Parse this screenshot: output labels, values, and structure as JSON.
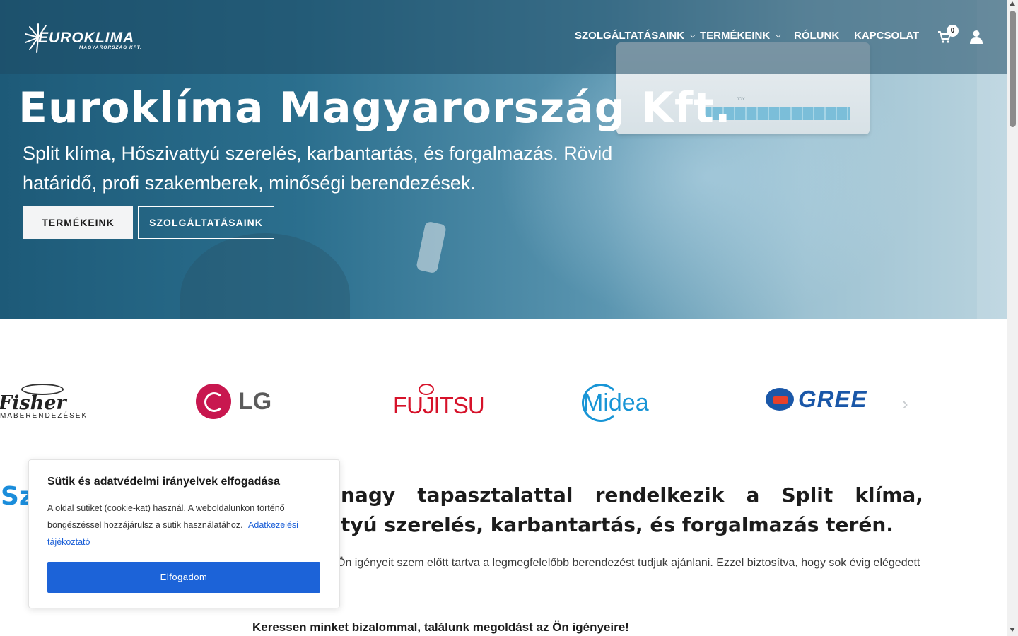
{
  "header": {
    "logo_text": "EUROKLIMA",
    "logo_subtext": "MAGYARORSZÁG KFT.",
    "nav": [
      {
        "label": "SZOLGÁLTATÁSAINK",
        "has_dropdown": true
      },
      {
        "label": "TERMÉKEINK",
        "has_dropdown": true
      },
      {
        "label": "RÓLUNK",
        "has_dropdown": false
      },
      {
        "label": "KAPCSOLAT",
        "has_dropdown": false
      }
    ],
    "cart_count": "0",
    "icons": {
      "cart": "cart-icon",
      "user": "user-icon",
      "dropdown": "chevron-down-icon"
    }
  },
  "hero": {
    "title": "Euroklíma Magyarország Kft.",
    "subtitle": "Split klíma, Hőszivattyú szerelés, karbantartás, és forgalmazás. Rövid határidő, profi szakemberek, minőségi berendezések.",
    "buttons": {
      "primary": "TERMÉKEINK",
      "secondary": "SZOLGÁLTATÁSAINK"
    },
    "ac_brand": "JOY"
  },
  "brands": [
    {
      "name": "Fisher",
      "subtext": "KLÍMABERENDEZÉSEK",
      "visible_word": "Fisher",
      "visible_sub": "MABERENDEZÉSEK"
    },
    {
      "name": "LG",
      "visible_word": "LG"
    },
    {
      "name": "FUJITSU",
      "visible_word": "FUJITSU"
    },
    {
      "name": "Midea",
      "visible_word": "Midea"
    },
    {
      "name": "GREE",
      "visible_word": "GREE"
    }
  ],
  "main": {
    "section_start": "Sz",
    "heading_words_line1": [
      "nagy",
      "tapasztalattal",
      "rendelkezik",
      "a",
      "Split",
      "klíma,"
    ],
    "heading_line2": "tyú szerelés, karbantartás, és forgalmazás terén.",
    "paragraph_line1": "Ön igényeit szem előtt tartva a legmegfelelőbb berendezést tudjuk ajánlani. Ezzel biztosítva, hogy sok évig elégedett",
    "paragraph_line2": ".",
    "cta_text": "Keressen minket bizalommal, találunk megoldást az Ön igényeire!"
  },
  "cookie": {
    "title": "Sütik és adatvédelmi irányelvek elfogadása",
    "body": "A oldal sütiket (cookie-kat) használ. A weboldalunkon történő böngészéssel hozzájárulsz a sütik használatához.",
    "link": "Adatkezelési tájékoztató",
    "button": "Elfogadom"
  },
  "colors": {
    "accent_blue": "#1b8ddb",
    "cookie_button": "#1c63d8",
    "fujitsu_red": "#d6122a",
    "lg_magenta": "#c8174f",
    "gree_blue": "#1a57a8",
    "midea_blue": "#1895d6"
  }
}
